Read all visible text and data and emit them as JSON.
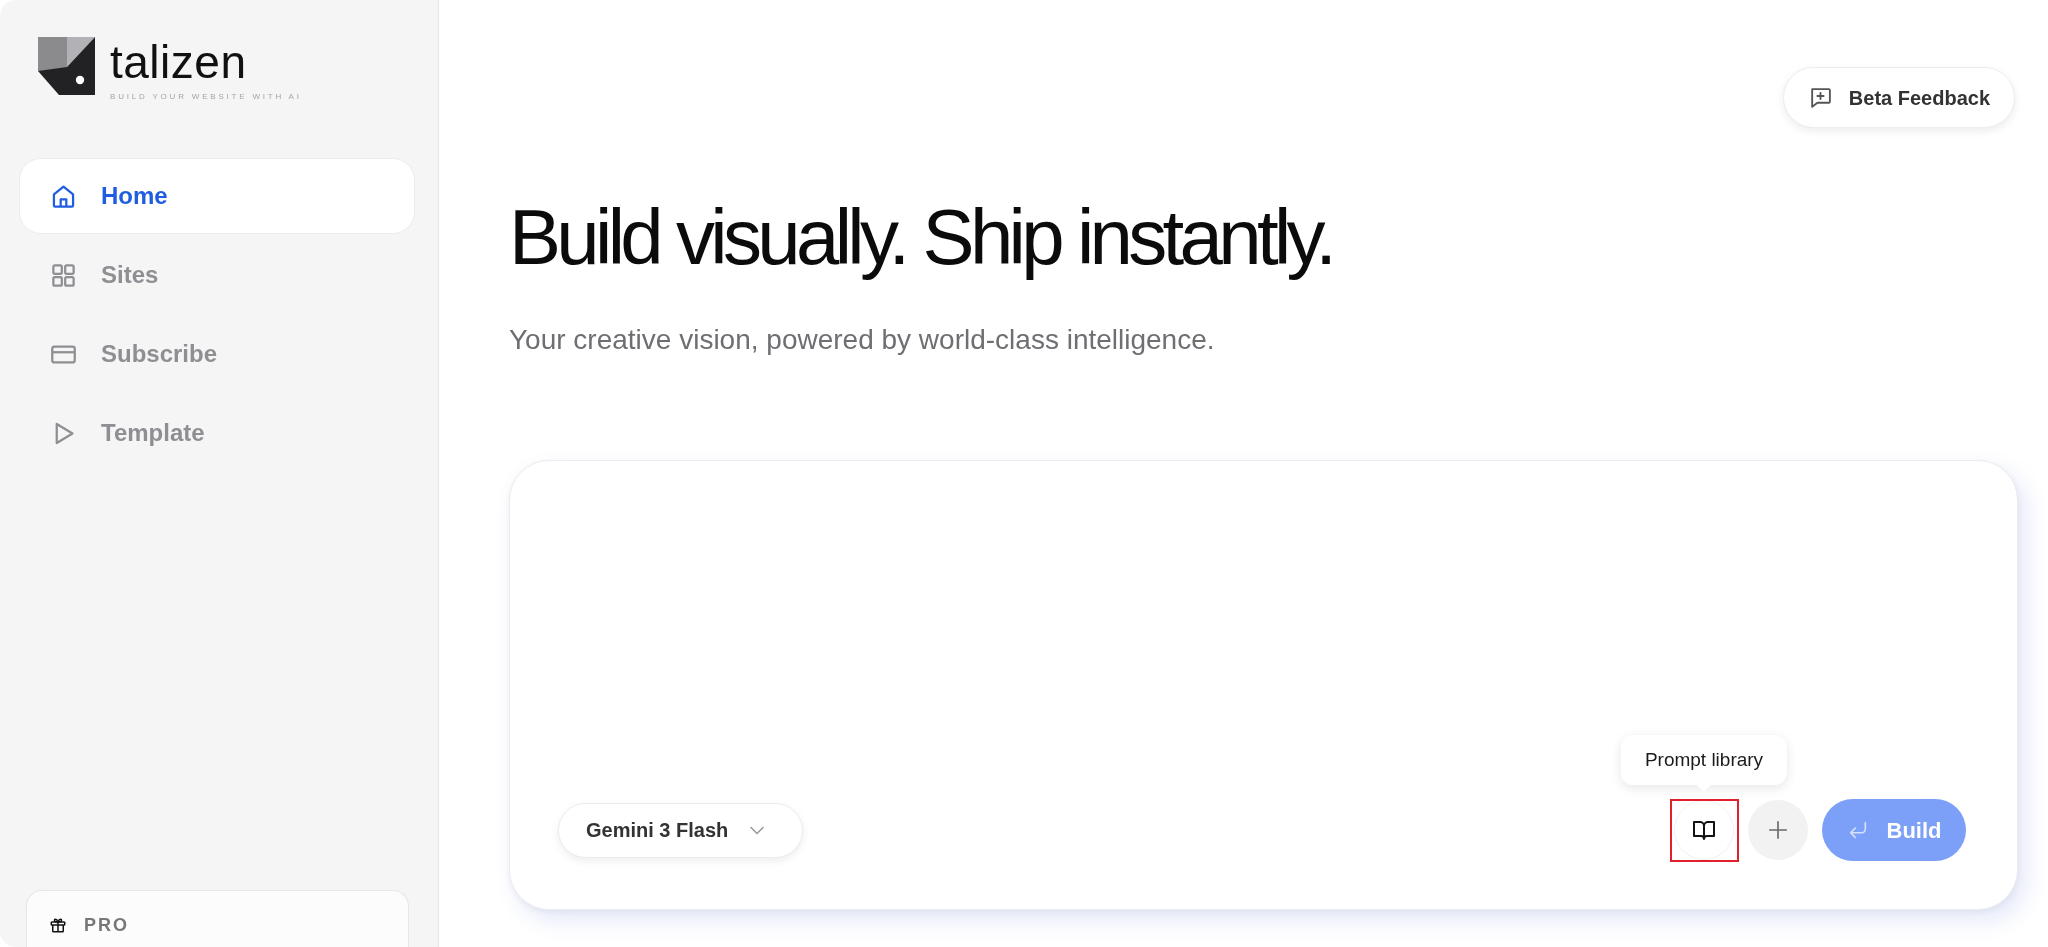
{
  "sidebar": {
    "logo": {
      "name": "talizen",
      "tagline": "BUILD YOUR WEBSITE WITH AI"
    },
    "items": [
      {
        "label": "Home",
        "selected": true
      },
      {
        "label": "Sites",
        "selected": false
      },
      {
        "label": "Subscribe",
        "selected": false
      },
      {
        "label": "Template",
        "selected": false
      }
    ],
    "plan_card": {
      "label": "PRO"
    }
  },
  "header": {
    "feedback_button": "Beta Feedback"
  },
  "hero": {
    "title": "Build visually. Ship instantly.",
    "subtitle": "Your creative vision, powered by world-class intelligence."
  },
  "composer": {
    "model": "Gemini 3 Flash",
    "prompt_library_button": {
      "tooltip": "Prompt library",
      "highlighted": true
    },
    "build_button": {
      "label": "Build",
      "disabled": true
    }
  }
}
